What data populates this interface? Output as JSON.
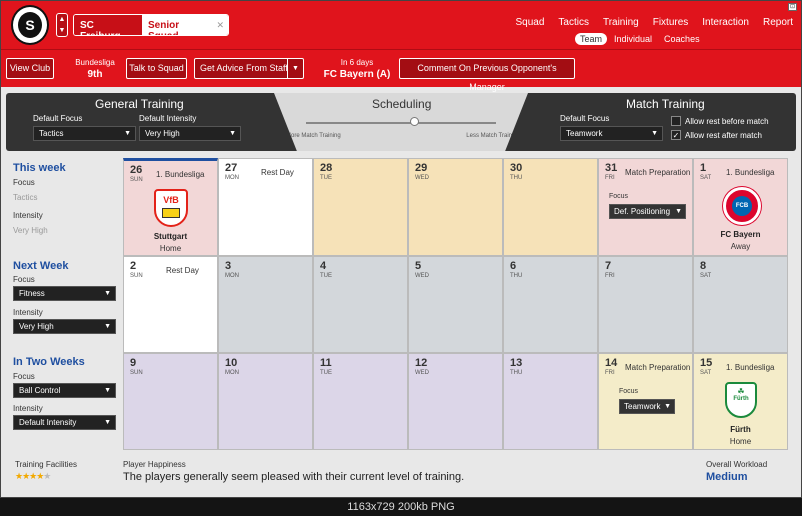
{
  "header": {
    "club": "SC Freiburg",
    "squad": "Senior Squad",
    "nav": [
      "Squad",
      "Tactics",
      "Training",
      "Fixtures",
      "Interaction",
      "Report"
    ],
    "subnav": [
      "Team",
      "Individual",
      "Coaches"
    ],
    "crest_text": "S"
  },
  "infobar": {
    "view_club": "View Club",
    "league_label": "Bundesliga",
    "league_pos": "9th",
    "talk_squad": "Talk to Squad",
    "advice": "Get Advice From Staff",
    "next_label": "In 6 days",
    "next_opponent": "FC Bayern (A)",
    "comment": "Comment On Previous Opponent's Manager"
  },
  "panel": {
    "general_title": "General Training",
    "focus_label": "Default Focus",
    "focus_value": "Tactics",
    "intensity_label": "Default Intensity",
    "intensity_value": "Very High",
    "scheduling_title": "Scheduling",
    "more_match": "More Match Training",
    "less_match": "Less Match Training",
    "match_title": "Match Training",
    "match_focus_label": "Default Focus",
    "match_focus_value": "Teamwork",
    "allow_before": "Allow rest before match",
    "allow_after": "Allow rest after match"
  },
  "weeks": [
    {
      "title": "This week",
      "focus_label": "Focus",
      "focus": "Tactics",
      "intensity_label": "Intensity",
      "intensity": "Very High",
      "editable": false
    },
    {
      "title": "Next Week",
      "focus_label": "Focus",
      "focus": "Fitness",
      "intensity_label": "Intensity",
      "intensity": "Very High",
      "editable": true
    },
    {
      "title": "In Two Weeks",
      "focus_label": "Focus",
      "focus": "Ball Control",
      "intensity_label": "Intensity",
      "intensity": "Default Intensity",
      "editable": true
    }
  ],
  "calendar": [
    [
      {
        "num": "26",
        "day": "SUN",
        "event": "1. Bundesliga",
        "team": "Stuttgart",
        "venue": "Home",
        "bg": "#f2d7d7"
      },
      {
        "num": "27",
        "day": "MON",
        "event": "Rest Day",
        "bg": "#ffffff"
      },
      {
        "num": "28",
        "day": "TUE",
        "bg": "#f6e2b8"
      },
      {
        "num": "29",
        "day": "WED",
        "bg": "#f6e2b8"
      },
      {
        "num": "30",
        "day": "THU",
        "bg": "#f6e2b8"
      },
      {
        "num": "31",
        "day": "FRI",
        "event": "Match Preparation",
        "focus_label": "Focus",
        "focus": "Def. Positioning",
        "bg": "#f2d7d7"
      },
      {
        "num": "1",
        "day": "SAT",
        "event": "1. Bundesliga",
        "team": "FC Bayern",
        "venue": "Away",
        "bg": "#f2d7d7"
      }
    ],
    [
      {
        "num": "2",
        "day": "SUN",
        "event": "Rest Day",
        "bg": "#ffffff"
      },
      {
        "num": "3",
        "day": "MON",
        "bg": "#d3d7db"
      },
      {
        "num": "4",
        "day": "TUE",
        "bg": "#d3d7db"
      },
      {
        "num": "5",
        "day": "WED",
        "bg": "#d3d7db"
      },
      {
        "num": "6",
        "day": "THU",
        "bg": "#d3d7db"
      },
      {
        "num": "7",
        "day": "FRI",
        "bg": "#d3d7db"
      },
      {
        "num": "8",
        "day": "SAT",
        "bg": "#d3d7db"
      }
    ],
    [
      {
        "num": "9",
        "day": "SUN",
        "bg": "#dcd6e8"
      },
      {
        "num": "10",
        "day": "MON",
        "bg": "#dcd6e8"
      },
      {
        "num": "11",
        "day": "TUE",
        "bg": "#dcd6e8"
      },
      {
        "num": "12",
        "day": "WED",
        "bg": "#dcd6e8"
      },
      {
        "num": "13",
        "day": "THU",
        "bg": "#dcd6e8"
      },
      {
        "num": "14",
        "day": "FRI",
        "event": "Match Preparation",
        "focus_label": "Focus",
        "focus": "Teamwork",
        "bg": "#f4ecc9"
      },
      {
        "num": "15",
        "day": "SAT",
        "event": "1. Bundesliga",
        "team": "Fürth",
        "venue": "Home",
        "bg": "#f4ecc9"
      }
    ]
  ],
  "footer": {
    "facilities_label": "Training Facilities",
    "stars_filled": "★★★★",
    "stars_empty": "★",
    "happiness_label": "Player Happiness",
    "happiness_text": "The players generally seem pleased with their current level of training.",
    "workload_label": "Overall Workload",
    "workload_value": "Medium"
  },
  "logos": {
    "stuttgart": "VfB",
    "bayern": "FCB",
    "furth": "Fürth"
  },
  "statusbar": "1163x729  200kb  PNG"
}
